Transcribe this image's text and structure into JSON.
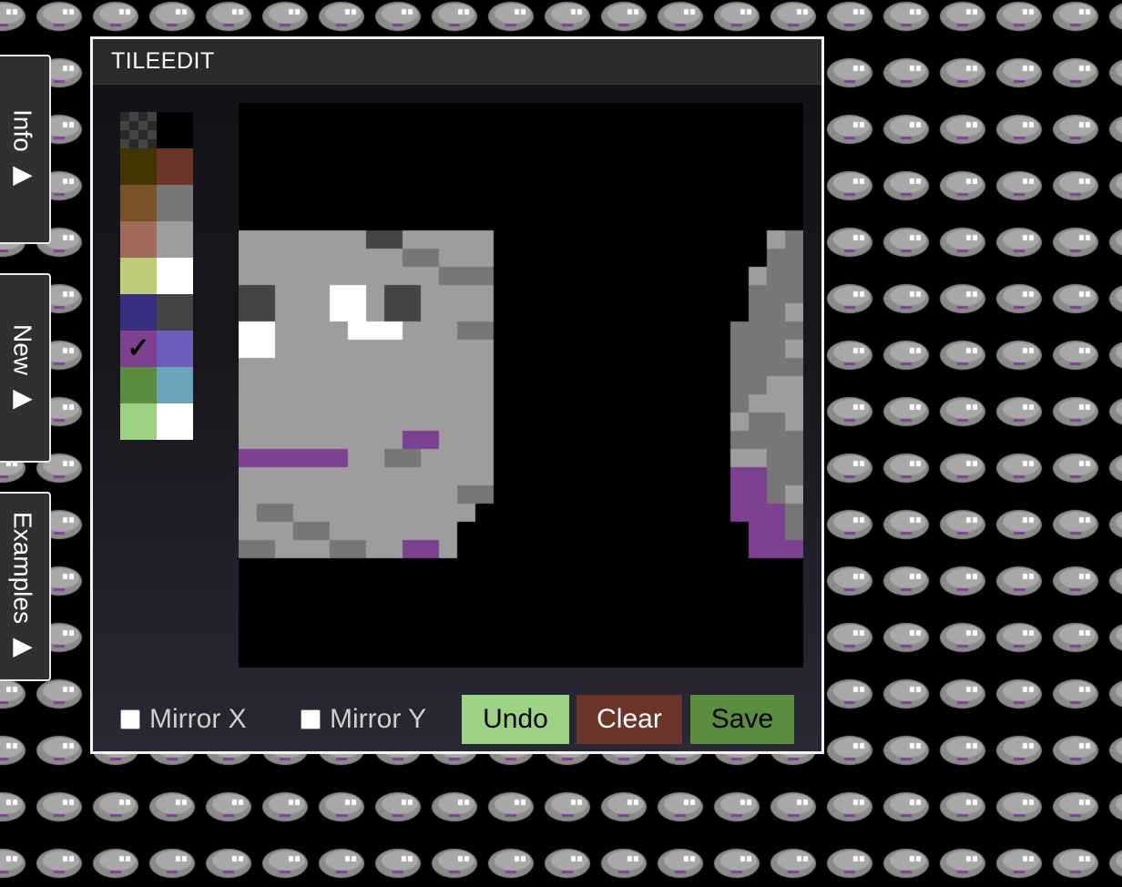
{
  "window": {
    "title": "TILEEDIT"
  },
  "side_tabs": [
    {
      "label": "Info ▶"
    },
    {
      "label": "New ▶"
    },
    {
      "label": "Examples ▶"
    }
  ],
  "palette": {
    "selected_index": 12,
    "selected_mark": "✓",
    "transparent_label": "",
    "colors": [
      "transparent",
      "#000000",
      "#413500",
      "#6c3529",
      "#775327",
      "#777777",
      "#a16a5b",
      "#9d9d9d",
      "#bfcb77",
      "#ffffff",
      "#392f80",
      "#444444",
      "#7d4191",
      "#6c5ebc",
      "#5a8d40",
      "#6aa4b6",
      "#9bd283",
      "#ffffff"
    ]
  },
  "controls": {
    "mirror_x": {
      "label": "Mirror X",
      "checked": false
    },
    "mirror_y": {
      "label": "Mirror Y",
      "checked": false
    },
    "undo": {
      "label": "Undo",
      "color": "#9bd283"
    },
    "clear": {
      "label": "Clear",
      "color": "#6c3529"
    },
    "save": {
      "label": "Save",
      "color": "#5a8d40"
    }
  },
  "tile": {
    "note_size": 16,
    "colors": {
      ".": "#000000",
      "L": "#9d9d9d",
      "M": "#777777",
      "D": "#444444",
      "W": "#ffffff",
      "P": "#7d4191"
    },
    "rows": [
      "................",
      "................",
      "................",
      "......LLLLLLLLLL",
      "LLMLLLLLLMMLMLLL",
      "LLLMMLLLLMMMMLLL",
      "DLLWDLMLLMLLLLWW",
      "DLLWDLLLLMLMMLWW",
      "WLLLWLLMMMMLLLWW",
      "WLLLLLLMMMMLLLLW",
      "LLLLLLLMMLLLLLLL",
      "LLLLLLLMLMMLLLLL",
      "LLLLLLLMLLLLLLLL",
      "LLLLLLLMMMLLLLLL",
      "LLLLLLLMLLLLLLLL",
      "LLLLLLLMLLLLLLLL"
    ]
  }
}
